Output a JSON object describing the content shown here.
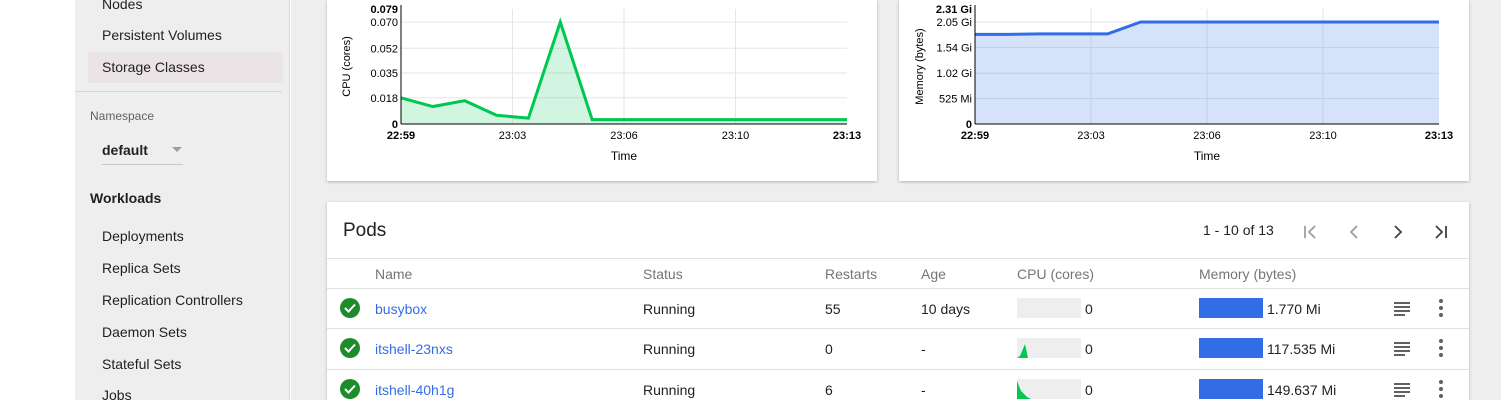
{
  "sidebar": {
    "items_top": [
      "Nodes",
      "Persistent Volumes",
      "Storage Classes"
    ],
    "namespace_label": "Namespace",
    "namespace_value": "default",
    "workloads_heading": "Workloads",
    "workload_items": [
      "Deployments",
      "Replica Sets",
      "Replication Controllers",
      "Daemon Sets",
      "Stateful Sets",
      "Jobs"
    ]
  },
  "cpu_chart": {
    "chart_data": {
      "type": "area",
      "ylabel": "CPU (cores)",
      "xlabel": "Time",
      "y_ticks": [
        "0",
        "0.018",
        "0.035",
        "0.052",
        "0.070",
        "0.079"
      ],
      "x_ticks": [
        "22:59",
        "23:03",
        "23:06",
        "23:10",
        "23:13"
      ],
      "ylim": [
        0,
        0.079
      ],
      "color": "#00c752",
      "series": [
        {
          "x": [
            "22:59",
            "23:00",
            "23:01",
            "23:02",
            "23:03",
            "23:04",
            "23:05",
            "23:06",
            "23:07",
            "23:08",
            "23:09",
            "23:10",
            "23:11",
            "23:12",
            "23:13"
          ],
          "values": [
            0.018,
            0.012,
            0.016,
            0.006,
            0.004,
            0.07,
            0.003,
            0.003,
            0.003,
            0.003,
            0.003,
            0.003,
            0.003,
            0.003,
            0.003
          ]
        }
      ]
    }
  },
  "mem_chart": {
    "chart_data": {
      "type": "area",
      "ylabel": "Memory (bytes)",
      "xlabel": "Time",
      "y_ticks": [
        "0",
        "525 Mi",
        "1.02 Gi",
        "1.54 Gi",
        "2.05 Gi",
        "2.31 Gi"
      ],
      "x_ticks": [
        "22:59",
        "23:03",
        "23:06",
        "23:10",
        "23:13"
      ],
      "ylim": [
        0,
        2.31
      ],
      "color": "#326de6",
      "series": [
        {
          "x": [
            "22:59",
            "23:00",
            "23:01",
            "23:02",
            "23:03",
            "23:04",
            "23:05",
            "23:06",
            "23:07",
            "23:08",
            "23:09",
            "23:10",
            "23:11",
            "23:12",
            "23:13"
          ],
          "values": [
            1.8,
            1.8,
            1.81,
            1.81,
            1.81,
            2.05,
            2.05,
            2.05,
            2.05,
            2.05,
            2.05,
            2.05,
            2.05,
            2.05,
            2.05
          ]
        }
      ]
    }
  },
  "pods": {
    "title": "Pods",
    "pager": "1 - 10 of 13",
    "columns": [
      "Name",
      "Status",
      "Restarts",
      "Age",
      "CPU (cores)",
      "Memory (bytes)"
    ],
    "rows": [
      {
        "name": "busybox",
        "status": "Running",
        "restarts": "55",
        "age": "10 days",
        "cpu": "0",
        "memory": "1.770 Mi",
        "cpu_spark": "none"
      },
      {
        "name": "itshell-23nxs",
        "status": "Running",
        "restarts": "0",
        "age": "-",
        "cpu": "0",
        "memory": "117.535 Mi",
        "cpu_spark": "spike"
      },
      {
        "name": "itshell-40h1g",
        "status": "Running",
        "restarts": "6",
        "age": "-",
        "cpu": "0",
        "memory": "149.637 Mi",
        "cpu_spark": "decay"
      }
    ]
  },
  "colors": {
    "accent": "#326de6",
    "cpu": "#00c752",
    "ok": "#1e8c2b"
  }
}
